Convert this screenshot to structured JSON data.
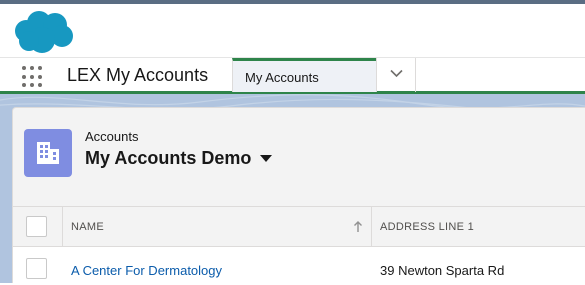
{
  "brand": {
    "logo_icon": "salesforce-cloud-icon",
    "logo_color": "#1798c1"
  },
  "nav": {
    "app_name": "LEX My Accounts",
    "tab_label": "My Accounts",
    "accent_color": "#2e844a"
  },
  "header": {
    "object_label": "Accounts",
    "list_view_name": "My Accounts Demo",
    "object_icon": "account-building-icon",
    "icon_color": "#7f8de1"
  },
  "table": {
    "columns": [
      "NAME",
      "ADDRESS LINE 1"
    ],
    "sort": {
      "column": "NAME",
      "direction": "ascending"
    },
    "rows": [
      {
        "name": "A Center For Dermatology",
        "address_line_1": "39 Newton Sparta Rd"
      }
    ]
  }
}
